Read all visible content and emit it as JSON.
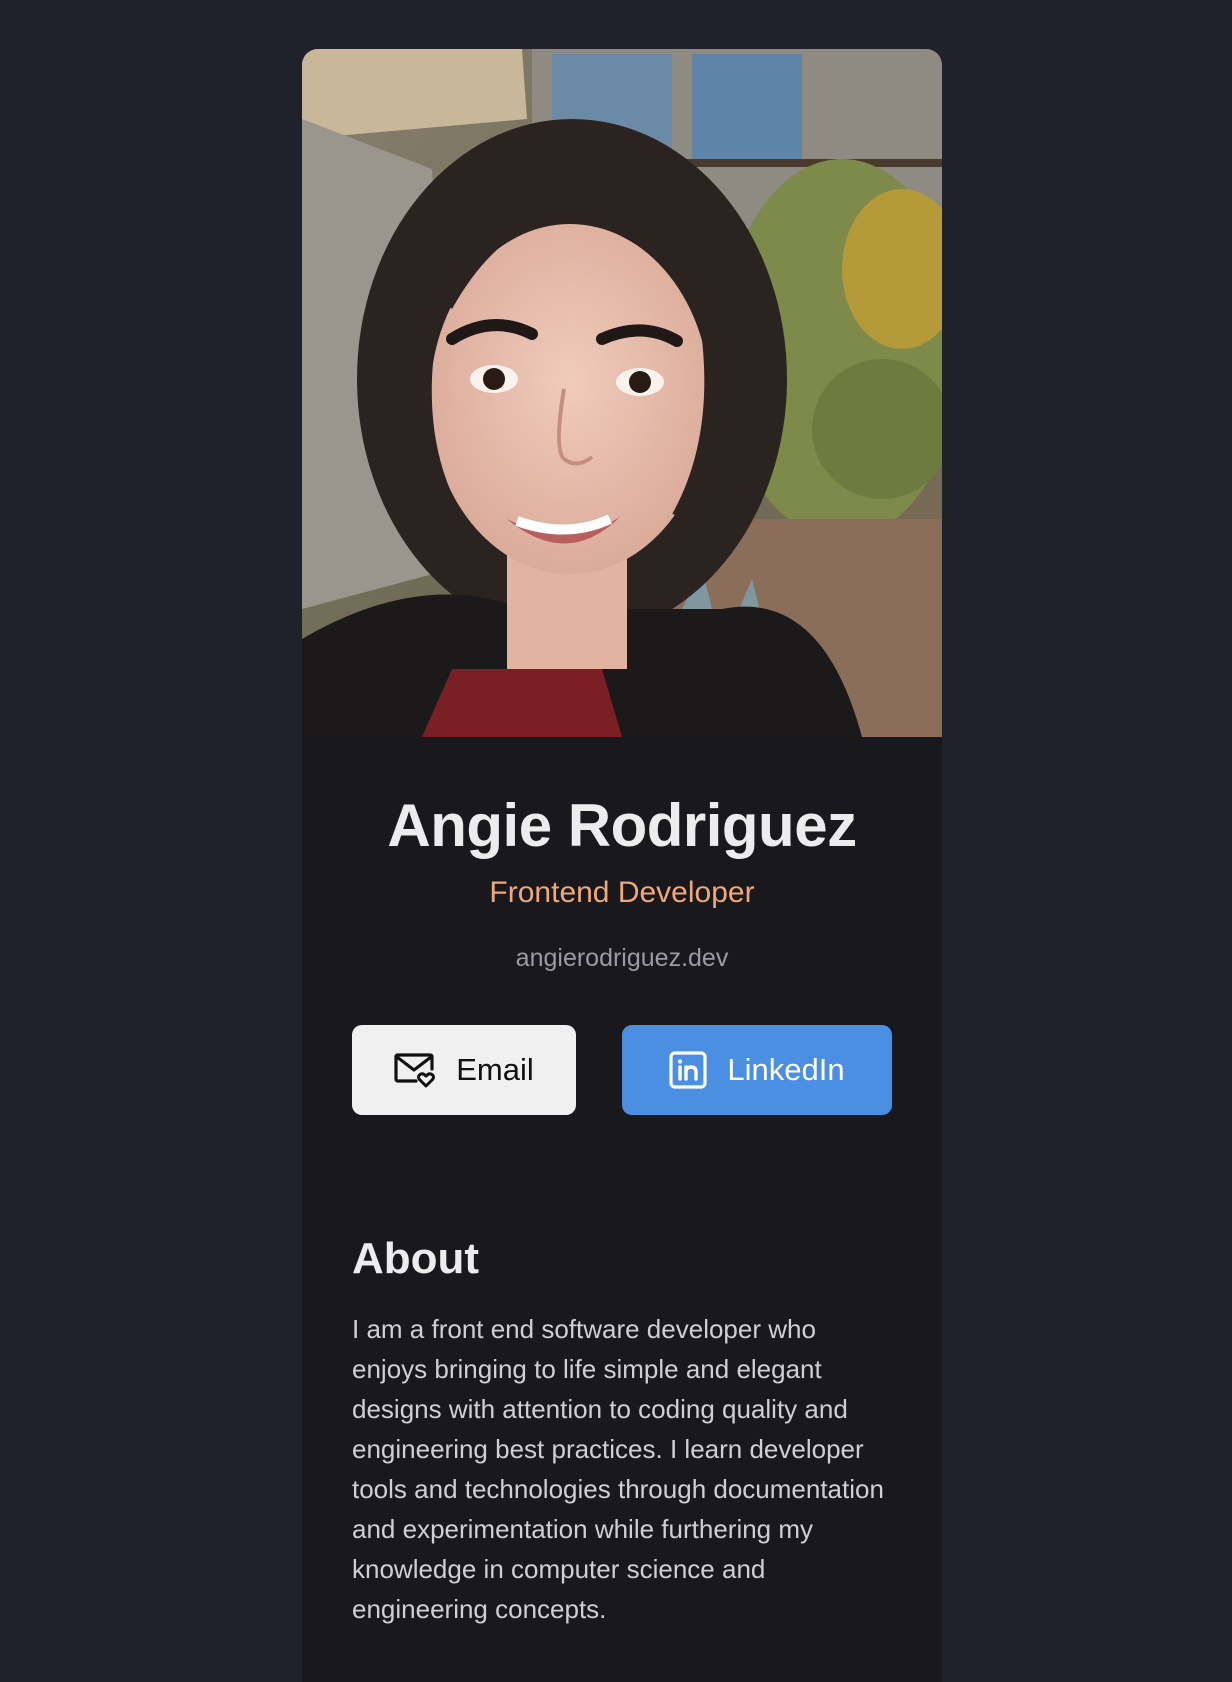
{
  "profile": {
    "photo_alt": "Portrait photo",
    "name": "Angie Rodriguez",
    "title": "Frontend Developer",
    "website": "angierodriguez.dev"
  },
  "buttons": {
    "email_label": "Email",
    "linkedin_label": "LinkedIn"
  },
  "about": {
    "heading": "About",
    "text": "I am a front end software developer who enjoys bringing to life simple and elegant designs with attention to coding quality and engineering best practices. I learn developer tools and technologies through documentation and experimentation while furthering my knowledge in computer science and engineering concepts."
  },
  "colors": {
    "page_background": "#20222b",
    "card_background": "#18181d",
    "accent_title": "#f0a878",
    "linkedin_blue": "#4a8fe2",
    "email_button": "#f0f0f0"
  },
  "icons": {
    "email": "envelope-heart-icon",
    "linkedin": "linkedin-icon"
  }
}
